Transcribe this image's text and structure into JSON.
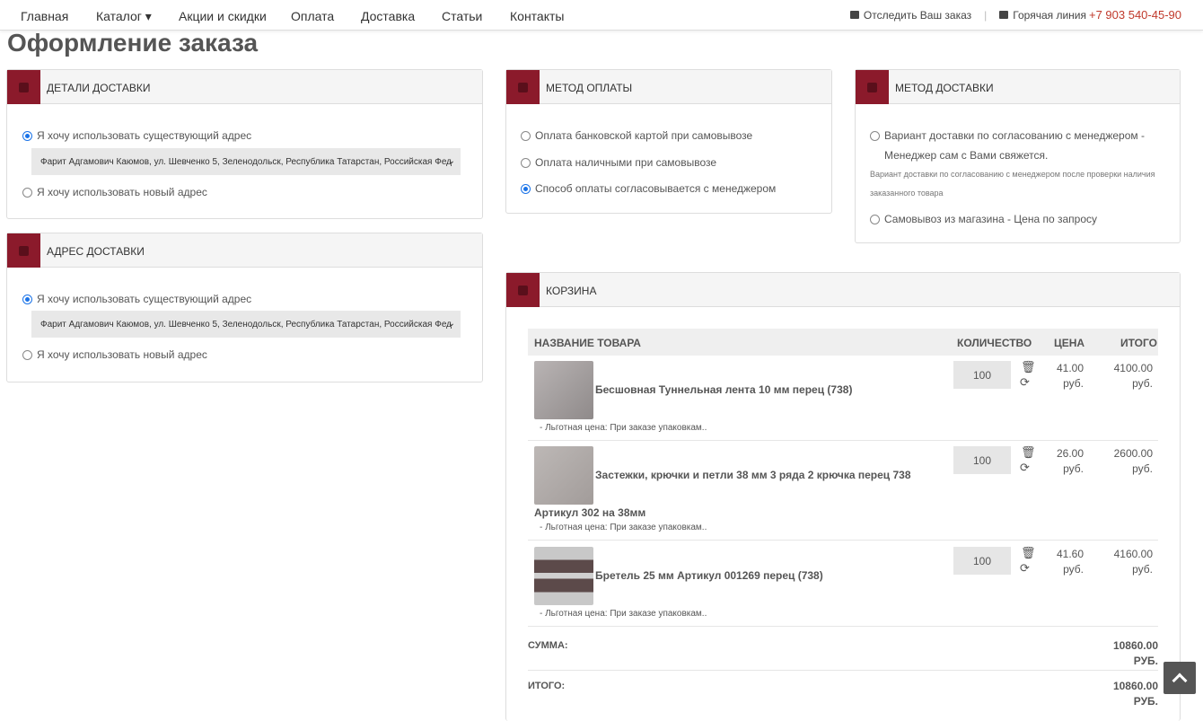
{
  "nav": {
    "items": [
      "Главная",
      "Каталог ▾",
      "Акции и скидки",
      "Оплата",
      "Доставка",
      "Статьи",
      "Контакты"
    ],
    "track": "Отследить Ваш заказ",
    "hotline": "Горячая линия",
    "phone": "+7 903 540-45-90"
  },
  "page_title": "Оформление заказа",
  "delivery_details": {
    "title": "ДЕТАЛИ ДОСТАВКИ",
    "opt_existing": "Я хочу использовать существующий адрес",
    "address": "Фарит Адгамович Каюмов, ул. Шевченко 5, Зеленодольск, Республика Татарстан, Российская Фед",
    "opt_new": "Я хочу использовать новый адрес"
  },
  "delivery_address": {
    "title": "АДРЕС ДОСТАВКИ",
    "opt_existing": "Я хочу использовать существующий адрес",
    "address": "Фарит Адгамович Каюмов, ул. Шевченко 5, Зеленодольск, Республика Татарстан, Российская Фед",
    "opt_new": "Я хочу использовать новый адрес"
  },
  "payment": {
    "title": "МЕТОД ОПЛАТЫ",
    "opts": [
      "Оплата банковской картой при самовывозе",
      "Оплата наличными при самовывозе",
      "Способ оплаты согласовывается с менеджером"
    ]
  },
  "shipping": {
    "title": "МЕТОД ДОСТАВКИ",
    "opt1_line1": "Вариант доставки по согласованию с менеджером -",
    "opt1_line2": "Менеджер сам с Вами свяжется.",
    "note_line1": "Вариант доставки по согласованию с менеджером после проверки наличия",
    "note_line2": "заказанного товара",
    "opt2": "Самовывоз из магазина - Цена по запросу"
  },
  "cart": {
    "title": "КОРЗИНА",
    "headers": {
      "name": "НАЗВАНИЕ ТОВАРА",
      "qty": "КОЛИЧЕСТВО",
      "price": "ЦЕНА",
      "total": "ИТОГО"
    },
    "items": [
      {
        "name": "Бесшовная Туннельная лента 10 мм перец (738)",
        "name2": "",
        "qty": "100",
        "price": "41.00",
        "total": "4100.00",
        "cur": "руб.",
        "note": "- Льготная цена: При заказе упаковкам.."
      },
      {
        "name": "Застежки, крючки и петли 38 мм 3 ряда 2 крючка перец 738",
        "name2": "Артикул 302 на 38мм",
        "qty": "100",
        "price": "26.00",
        "total": "2600.00",
        "cur": "руб.",
        "note": "- Льготная цена: При заказе упаковкам.."
      },
      {
        "name": "Бретель 25 мм Артикул 001269 перец (738)",
        "name2": "",
        "qty": "100",
        "price": "41.60",
        "total": "4160.00",
        "cur": "руб.",
        "note": "- Льготная цена: При заказе упаковкам.."
      }
    ],
    "sum_label": "СУММА:",
    "sum": "10860.00",
    "sum_cur": "РУБ.",
    "total_label": "ИТОГО:",
    "total": "10860.00",
    "total_cur": "РУБ."
  },
  "colors": {
    "accent": "#8b1a2b",
    "phone": "#c0392b",
    "radio": "#1a73e8"
  }
}
